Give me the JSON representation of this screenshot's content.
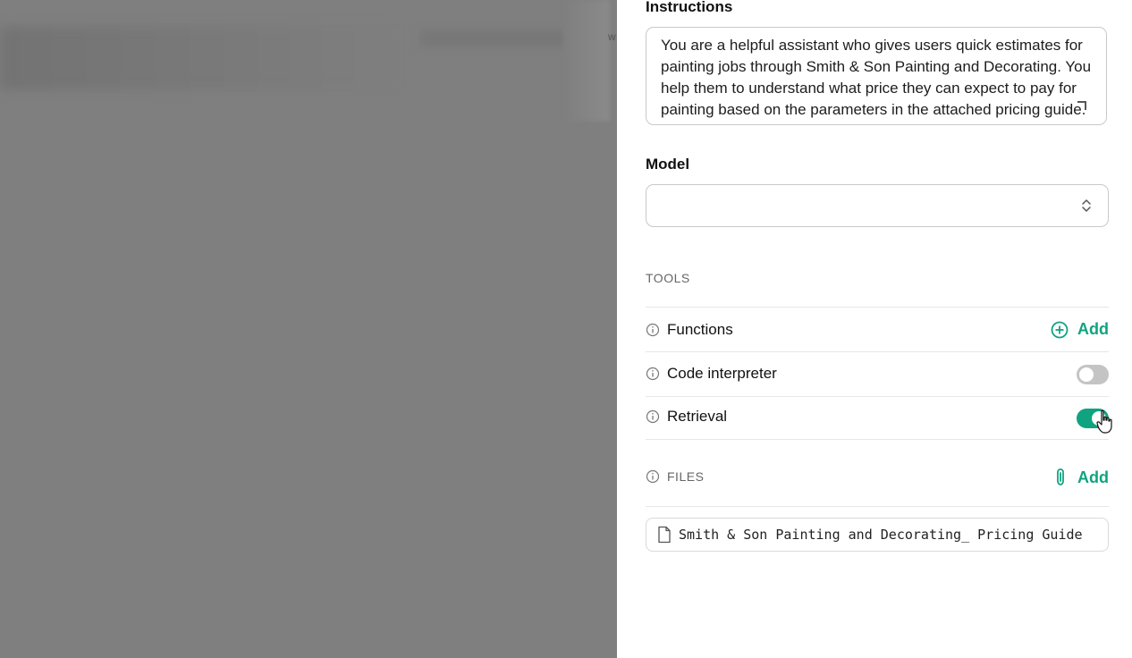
{
  "background": {
    "partial_glyph": "w"
  },
  "instructions": {
    "label": "Instructions",
    "text": "You are a helpful assistant who gives users quick estimates for painting jobs through Smith & Son Painting and Decorating. You help them to understand what price they can expect to pay for painting based on the parameters in the attached pricing guide."
  },
  "model": {
    "label": "Model",
    "value": ""
  },
  "tools": {
    "section_title": "TOOLS",
    "functions": {
      "label": "Functions",
      "add_label": "Add"
    },
    "code_interpreter": {
      "label": "Code interpreter",
      "enabled": false
    },
    "retrieval": {
      "label": "Retrieval",
      "enabled": true
    }
  },
  "files": {
    "section_title": "FILES",
    "add_label": "Add",
    "items": [
      {
        "name": "Smith & Son Painting and Decorating_ Pricing Guide"
      }
    ]
  },
  "colors": {
    "accent": "#10a37f",
    "overlay": "#7f7f7f",
    "toggle_off": "#c4c4c4"
  },
  "icons": {
    "info": "info-icon",
    "add_circle": "plus-circle-icon",
    "paperclip": "paperclip-icon",
    "file": "file-icon",
    "chevron": "chevron-updown-icon",
    "cursor": "hand-cursor-icon"
  }
}
